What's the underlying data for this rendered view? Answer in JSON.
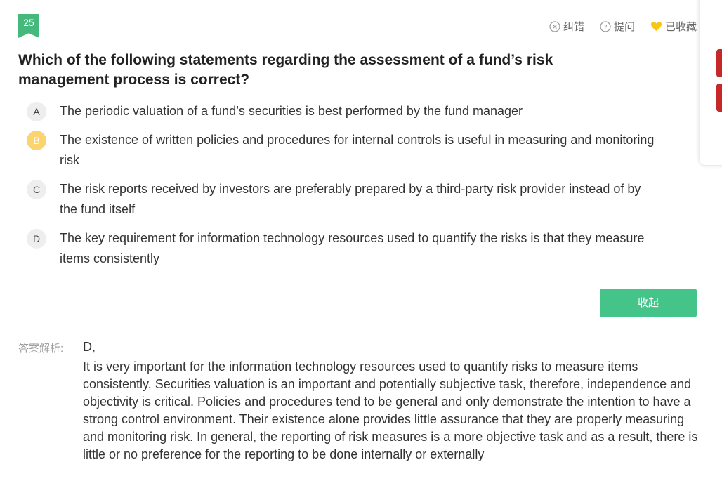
{
  "question_number": "25",
  "actions": [
    {
      "label": "纠错",
      "icon": "close-circle-icon"
    },
    {
      "label": "提问",
      "icon": "question-circle-icon"
    },
    {
      "label": "已收藏",
      "icon": "heart-icon",
      "color": "#f5c518"
    }
  ],
  "question": "Which of the following statements regarding the assessment of a fund’s risk management process is correct?",
  "options": [
    {
      "letter": "A",
      "text": "The periodic valuation of a fund’s securities is best performed by the fund manager"
    },
    {
      "letter": "B",
      "text": "The existence of written policies and procedures for internal controls is useful in measuring and monitoring risk",
      "selected": true
    },
    {
      "letter": "C",
      "text": "The risk reports received by investors are preferably prepared by a third-party risk provider instead of by the fund itself"
    },
    {
      "letter": "D",
      "text": "The key requirement for information technology resources used to quantify the risks is that they measure items consistently"
    }
  ],
  "collapse_label": "收起",
  "analysis": {
    "label": "答案解析:",
    "answer": "D,",
    "text": "It is very important for the information technology resources used to quantify risks to measure items consistently. Securities valuation is an important and potentially subjective task, therefore, independence and objectivity is critical. Policies and procedures tend to be general and only demonstrate the intention to have a strong control environment. Their existence alone provides little assurance that they are properly measuring and monitoring risk. In general, the reporting of risk measures is a more objective task and as a result, there is little or no preference for the reporting to be done internally or externally"
  },
  "colors": {
    "accent": "#45c48a",
    "selected": "#fbd46d",
    "badge": "#45b97c"
  }
}
